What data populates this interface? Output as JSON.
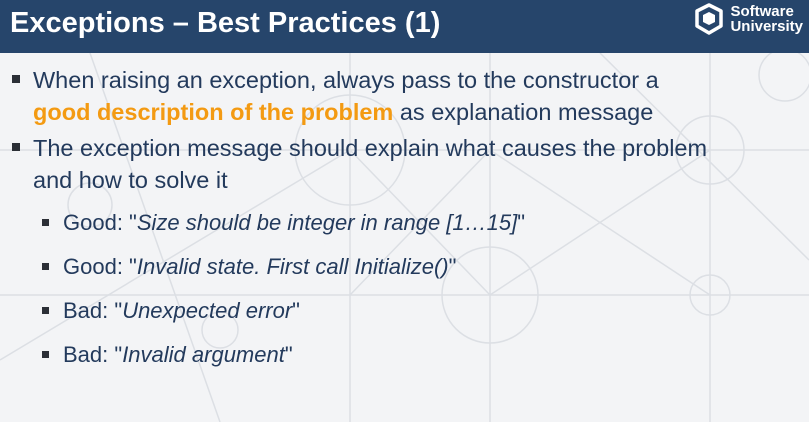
{
  "header": {
    "title": "Exceptions – Best Practices (1)",
    "logo": {
      "line1": "Software",
      "line2": "University",
      "icon": "softuni-logo-icon"
    }
  },
  "bullets": [
    {
      "pre": "When raising an exception, always pass to the constructor a",
      "highlight": "good description of the problem",
      "post": " as explanation message"
    },
    {
      "line1": "The exception message should explain what causes the problem",
      "line2": "and how to solve it"
    }
  ],
  "examples": [
    {
      "label": "Good: \"",
      "text": "Size should be integer in range [1…15]",
      "close": "\""
    },
    {
      "label": "Good: \"",
      "text": "Invalid state. First call Initialize()",
      "close": "\""
    },
    {
      "label": "Bad: \"",
      "text": "Unexpected error",
      "close": "\""
    },
    {
      "label": "Bad: \"",
      "text": "Invalid argument",
      "close": "\""
    }
  ],
  "colors": {
    "header_bg": "#26456b",
    "highlight": "#f39a12",
    "text": "#233a5c",
    "background": "#f3f4f6"
  }
}
